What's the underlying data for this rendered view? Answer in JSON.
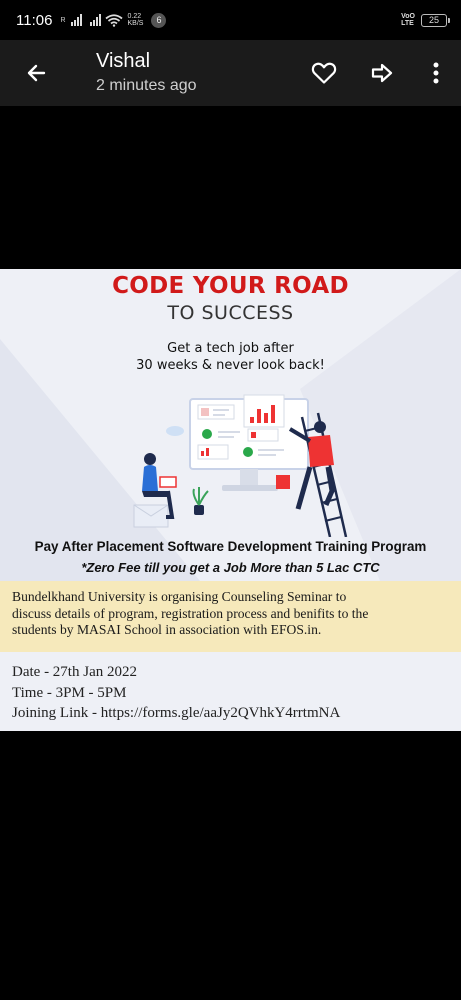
{
  "status_bar": {
    "time": "11:06",
    "network_speed_value": "0.22",
    "network_speed_unit": "KB/S",
    "notification_count": "6",
    "volte_line1": "VoO",
    "volte_line2": "LTE",
    "battery_level": "25"
  },
  "app_bar": {
    "sender_name": "Vishal",
    "timestamp": "2 minutes ago"
  },
  "icons": {
    "back": "arrow-left-icon",
    "favorite": "heart-outline-icon",
    "forward": "forward-arrow-icon",
    "more": "more-vert-icon"
  },
  "image": {
    "headline": "CODE YOUR ROAD",
    "subheadline": "TO SUCCESS",
    "tagline_line1": "Get a tech job after",
    "tagline_line2": "30 weeks & never look back!",
    "program_title": "Pay After Placement Software Development Training Program",
    "fee_note": "*Zero Fee till you get a Job More than 5 Lac CTC",
    "seminar_line1": "Bundelkhand University is organising Counseling Seminar to",
    "seminar_line2": "discuss details of program, registration process and benifits to the",
    "seminar_line3": "students by MASAI School in association with EFOS.in.",
    "date": "Date - 27th Jan 2022",
    "time": "Time - 3PM - 5PM",
    "joining_link": "Joining Link - https://forms.gle/aaJy2QVhkY4rrtmNA",
    "colors": {
      "headline": "#d11a1a",
      "seminar_background": "#f6e9bb",
      "poster_background": "#eef0f6"
    }
  }
}
